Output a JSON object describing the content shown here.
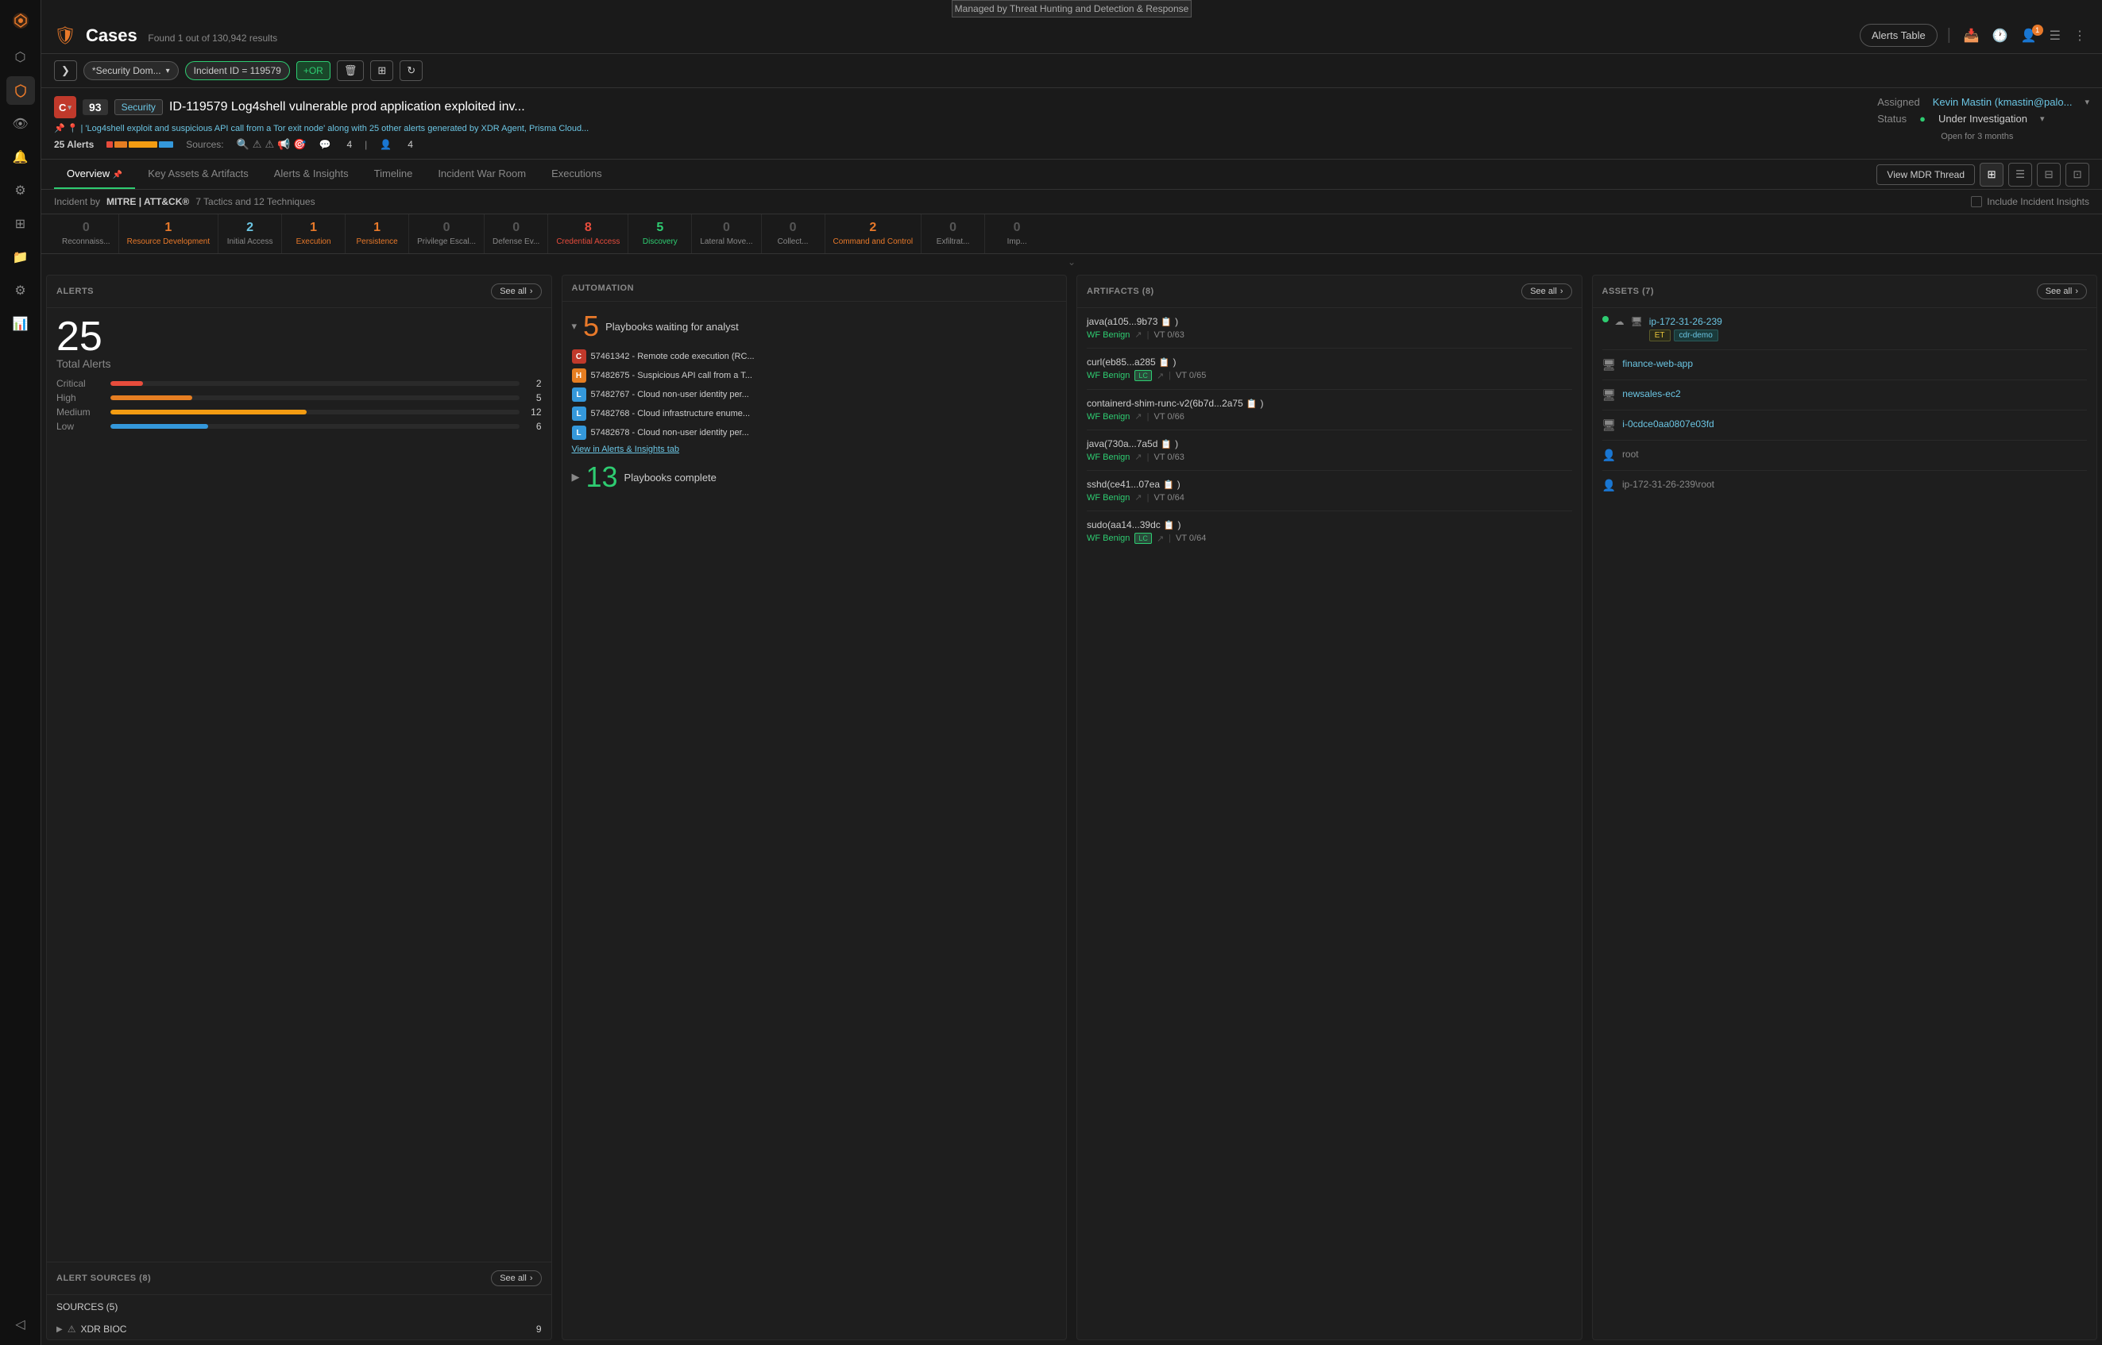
{
  "banner": {
    "text": "Managed by Threat Hunting and Detection & Response"
  },
  "header": {
    "title": "Cases",
    "subtitle": "Found 1 out of 130,942 results",
    "alerts_table": "Alerts Table",
    "notification_count": "1"
  },
  "filters": [
    {
      "label": "*Security Dom...",
      "type": "dropdown"
    },
    {
      "label": "Incident ID = 119579",
      "type": "tag"
    }
  ],
  "or_btn": "+OR",
  "case": {
    "badge": "C",
    "severity_num": "93",
    "severity_tag": "Security",
    "title": "ID-119579 Log4shell vulnerable prod application exploited inv...",
    "meta_text": "'Log4shell exploit and suspicious API call from a Tor exit node' along with 25 other alerts generated by XDR Agent, Prisma Cloud...",
    "alerts_count": "25 Alerts",
    "sources_label": "Sources:",
    "chat_count": "4",
    "user_count": "4",
    "assigned_label": "Assigned",
    "assigned_value": "Kevin Mastin (kmastin@palo...",
    "status_label": "Status",
    "status_value": "Under Investigation",
    "status_time": "Open for 3 months"
  },
  "tabs": [
    {
      "label": "Overview",
      "active": true
    },
    {
      "label": "Key Assets & Artifacts"
    },
    {
      "label": "Alerts & Insights"
    },
    {
      "label": "Timeline"
    },
    {
      "label": "Incident War Room"
    },
    {
      "label": "Executions"
    }
  ],
  "tab_actions": {
    "view_mdr": "View MDR Thread"
  },
  "mitre": {
    "prefix": "Incident by",
    "logo": "MITRE | ATT&CK®",
    "tactics_label": "7 Tactics and 12 Techniques",
    "include_insights": "Include Incident Insights"
  },
  "tactics": [
    {
      "count": "0",
      "name": "Reconnaiss...",
      "color": "zero"
    },
    {
      "count": "1",
      "name": "Resource Development",
      "color": "orange"
    },
    {
      "count": "2",
      "name": "Initial Access",
      "color": "blue"
    },
    {
      "count": "1",
      "name": "Execution",
      "color": "orange"
    },
    {
      "count": "1",
      "name": "Persistence",
      "color": "orange"
    },
    {
      "count": "0",
      "name": "Privilege Escal...",
      "color": "zero"
    },
    {
      "count": "0",
      "name": "Defense Ev...",
      "color": "zero"
    },
    {
      "count": "8",
      "name": "Credential Access",
      "color": "red"
    },
    {
      "count": "5",
      "name": "Discovery",
      "color": "green"
    },
    {
      "count": "0",
      "name": "Lateral Move...",
      "color": "zero"
    },
    {
      "count": "0",
      "name": "Collect...",
      "color": "zero"
    },
    {
      "count": "2",
      "name": "Command and Control",
      "color": "orange"
    },
    {
      "count": "0",
      "name": "Exfiltrat...",
      "color": "zero"
    },
    {
      "count": "0",
      "name": "Imp...",
      "color": "zero"
    }
  ],
  "panels": {
    "alerts": {
      "title": "ALERTS",
      "see_all": "See all",
      "total": "25",
      "total_label": "Total Alerts",
      "severities": [
        {
          "label": "Critical",
          "count": "2",
          "pct": 8,
          "type": "critical"
        },
        {
          "label": "High",
          "count": "5",
          "pct": 20,
          "type": "high"
        },
        {
          "label": "Medium",
          "count": "12",
          "pct": 48,
          "type": "medium"
        },
        {
          "label": "Low",
          "count": "6",
          "pct": 24,
          "type": "low"
        }
      ]
    },
    "automation": {
      "title": "AUTOMATION",
      "waiting_count": "5",
      "waiting_label": "Playbooks waiting for analyst",
      "playbooks": [
        {
          "id": "57461342",
          "text": "57461342 - Remote code execution (RC...",
          "type": "C"
        },
        {
          "id": "57482675",
          "text": "57482675 - Suspicious API call from a T...",
          "type": "H"
        },
        {
          "id": "57482767",
          "text": "57482767 - Cloud non-user identity per...",
          "type": "L"
        },
        {
          "id": "57482768",
          "text": "57482768 - Cloud infrastructure enume...",
          "type": "L"
        },
        {
          "id": "57482678",
          "text": "57482678 - Cloud non-user identity per...",
          "type": "L"
        }
      ],
      "view_insights": "View in Alerts & Insights tab",
      "complete_count": "13",
      "complete_label": "Playbooks complete"
    },
    "artifacts": {
      "title": "ARTIFACTS (8)",
      "see_all": "See all",
      "items": [
        {
          "name": "java(a105...9b73",
          "wf": "WF Benign",
          "vt": "VT 0/63",
          "has_share": true,
          "has_lc": false
        },
        {
          "name": "curl(eb85...a285",
          "wf": "WF Benign",
          "vt": "VT 0/65",
          "has_share": true,
          "has_lc": true
        },
        {
          "name": "containerd-shim-runc-v2(6b7d...2a75",
          "wf": "WF Benign",
          "vt": "VT 0/66",
          "has_share": true,
          "has_lc": false
        },
        {
          "name": "java(730a...7a5d",
          "wf": "WF Benign",
          "vt": "VT 0/63",
          "has_share": true,
          "has_lc": false
        },
        {
          "name": "sshd(ce41...07ea",
          "wf": "WF Benign",
          "vt": "VT 0/64",
          "has_share": true,
          "has_lc": false
        },
        {
          "name": "sudo(aa14...39dc",
          "wf": "WF Benign",
          "vt": "VT 0/64",
          "has_share": true,
          "has_lc": true
        }
      ]
    },
    "assets": {
      "title": "ASSETS (7)",
      "see_all": "See all",
      "items": [
        {
          "name": "ip-172-31-26-239",
          "type": "server",
          "online": true,
          "tags": [
            "ET",
            "cdr-demo"
          ]
        },
        {
          "name": "finance-web-app",
          "type": "app",
          "online": false,
          "tags": []
        },
        {
          "name": "newsales-ec2",
          "type": "app",
          "online": false,
          "tags": []
        },
        {
          "name": "i-0cdce0aa0807e03fd",
          "type": "app",
          "online": false,
          "tags": []
        },
        {
          "name": "root",
          "type": "user",
          "online": false,
          "tags": []
        },
        {
          "name": "ip-172-31-26-239\\root",
          "type": "user",
          "online": false,
          "tags": []
        }
      ]
    },
    "alert_sources": {
      "title": "ALERT SOURCES (8)",
      "see_all": "See all",
      "sources_count": "SOURCES (5)",
      "xdr_bioc": "XDR BIOC",
      "xdr_bioc_count": "9"
    }
  }
}
